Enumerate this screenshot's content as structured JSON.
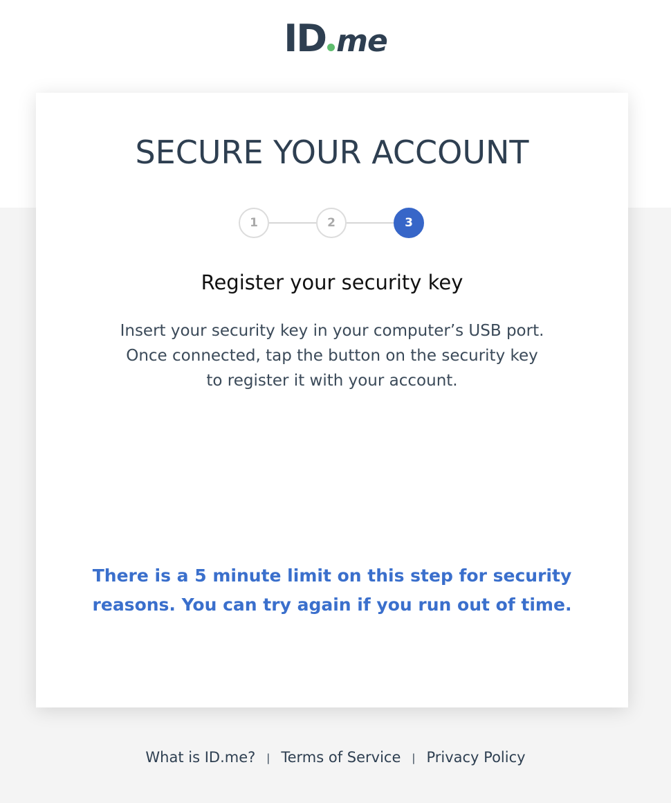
{
  "logo": {
    "id_text": "ID",
    "me_text": "me",
    "dot_color": "#5fbd6e"
  },
  "card": {
    "title": "SECURE YOUR ACCOUNT",
    "steps": [
      {
        "label": "1",
        "state": "inactive"
      },
      {
        "label": "2",
        "state": "inactive"
      },
      {
        "label": "3",
        "state": "active"
      }
    ],
    "current_step": 3,
    "subtitle": "Register your security key",
    "instructions": [
      "Insert your security key in your computer’s USB port.",
      "Once connected, tap the button on the security key",
      "to register it with your account."
    ],
    "notice_lines": [
      "There is a 5 minute limit on this step for security",
      "reasons. You can try again if you run out of time."
    ]
  },
  "footer": {
    "links": [
      {
        "label": "What is ID.me?"
      },
      {
        "label": "Terms of Service"
      },
      {
        "label": "Privacy Policy"
      }
    ],
    "separator": "|"
  },
  "colors": {
    "primary_dark": "#2e3f51",
    "accent_blue": "#3766c8",
    "notice_blue": "#3a6fcc",
    "page_background": "#f4f4f4"
  }
}
